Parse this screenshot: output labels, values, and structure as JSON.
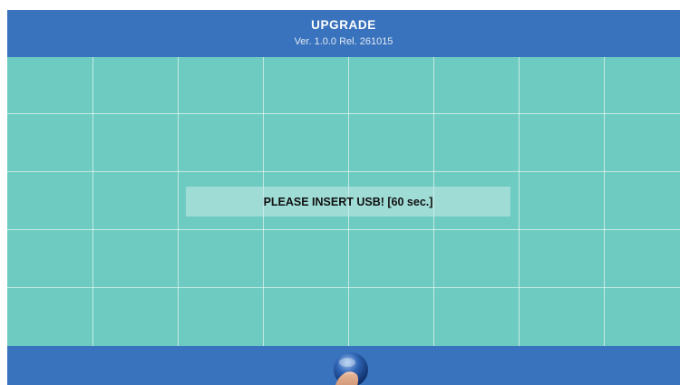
{
  "header": {
    "title": "UPGRADE",
    "version": "Ver. 1.0.0 Rel. 261015"
  },
  "dialog": {
    "message": "PLEASE INSERT USB! [60 sec.]"
  },
  "footer": {
    "button_icon": "touch-hand-icon"
  },
  "colors": {
    "header_bg": "#3a73bd",
    "grid_bg": "#6ecbc1",
    "footer_bg": "#3a73bd"
  }
}
